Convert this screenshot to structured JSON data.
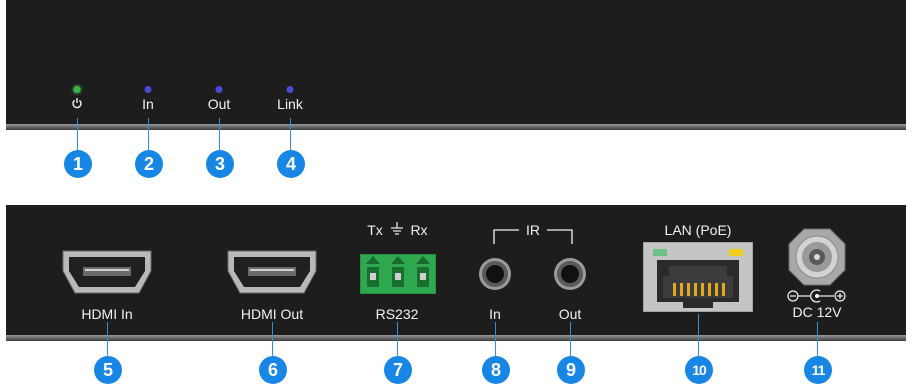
{
  "front": {
    "indicators": [
      {
        "label": "",
        "icon": "power-icon",
        "color": "#39b54a"
      },
      {
        "label": "In",
        "icon": "led-icon",
        "color": "#4a4ad8"
      },
      {
        "label": "Out",
        "icon": "led-icon",
        "color": "#4a4ad8"
      },
      {
        "label": "Link",
        "icon": "led-icon",
        "color": "#4a4ad8"
      }
    ],
    "callouts": [
      "1",
      "2",
      "3",
      "4"
    ]
  },
  "rear": {
    "hdmi_in": "HDMI In",
    "hdmi_out": "HDMI Out",
    "rs232": {
      "label": "RS232",
      "tx": "Tx",
      "rx": "Rx",
      "ground_icon": "ground-icon",
      "color": "#2fa84f"
    },
    "ir": {
      "label": "IR",
      "in": "In",
      "out": "Out"
    },
    "lan": {
      "label": "LAN (PoE)",
      "led_left_color": "#6cc08a",
      "led_right_color": "#f0d020"
    },
    "dc": {
      "label": "DC 12V",
      "polarity_icon": "dc-polarity-icon"
    },
    "callouts": [
      "5",
      "6",
      "7",
      "8",
      "9",
      "10",
      "11"
    ]
  },
  "colors": {
    "panel": "#1d1d1d",
    "callout": "#1786e4",
    "label": "#f2f2f2"
  }
}
